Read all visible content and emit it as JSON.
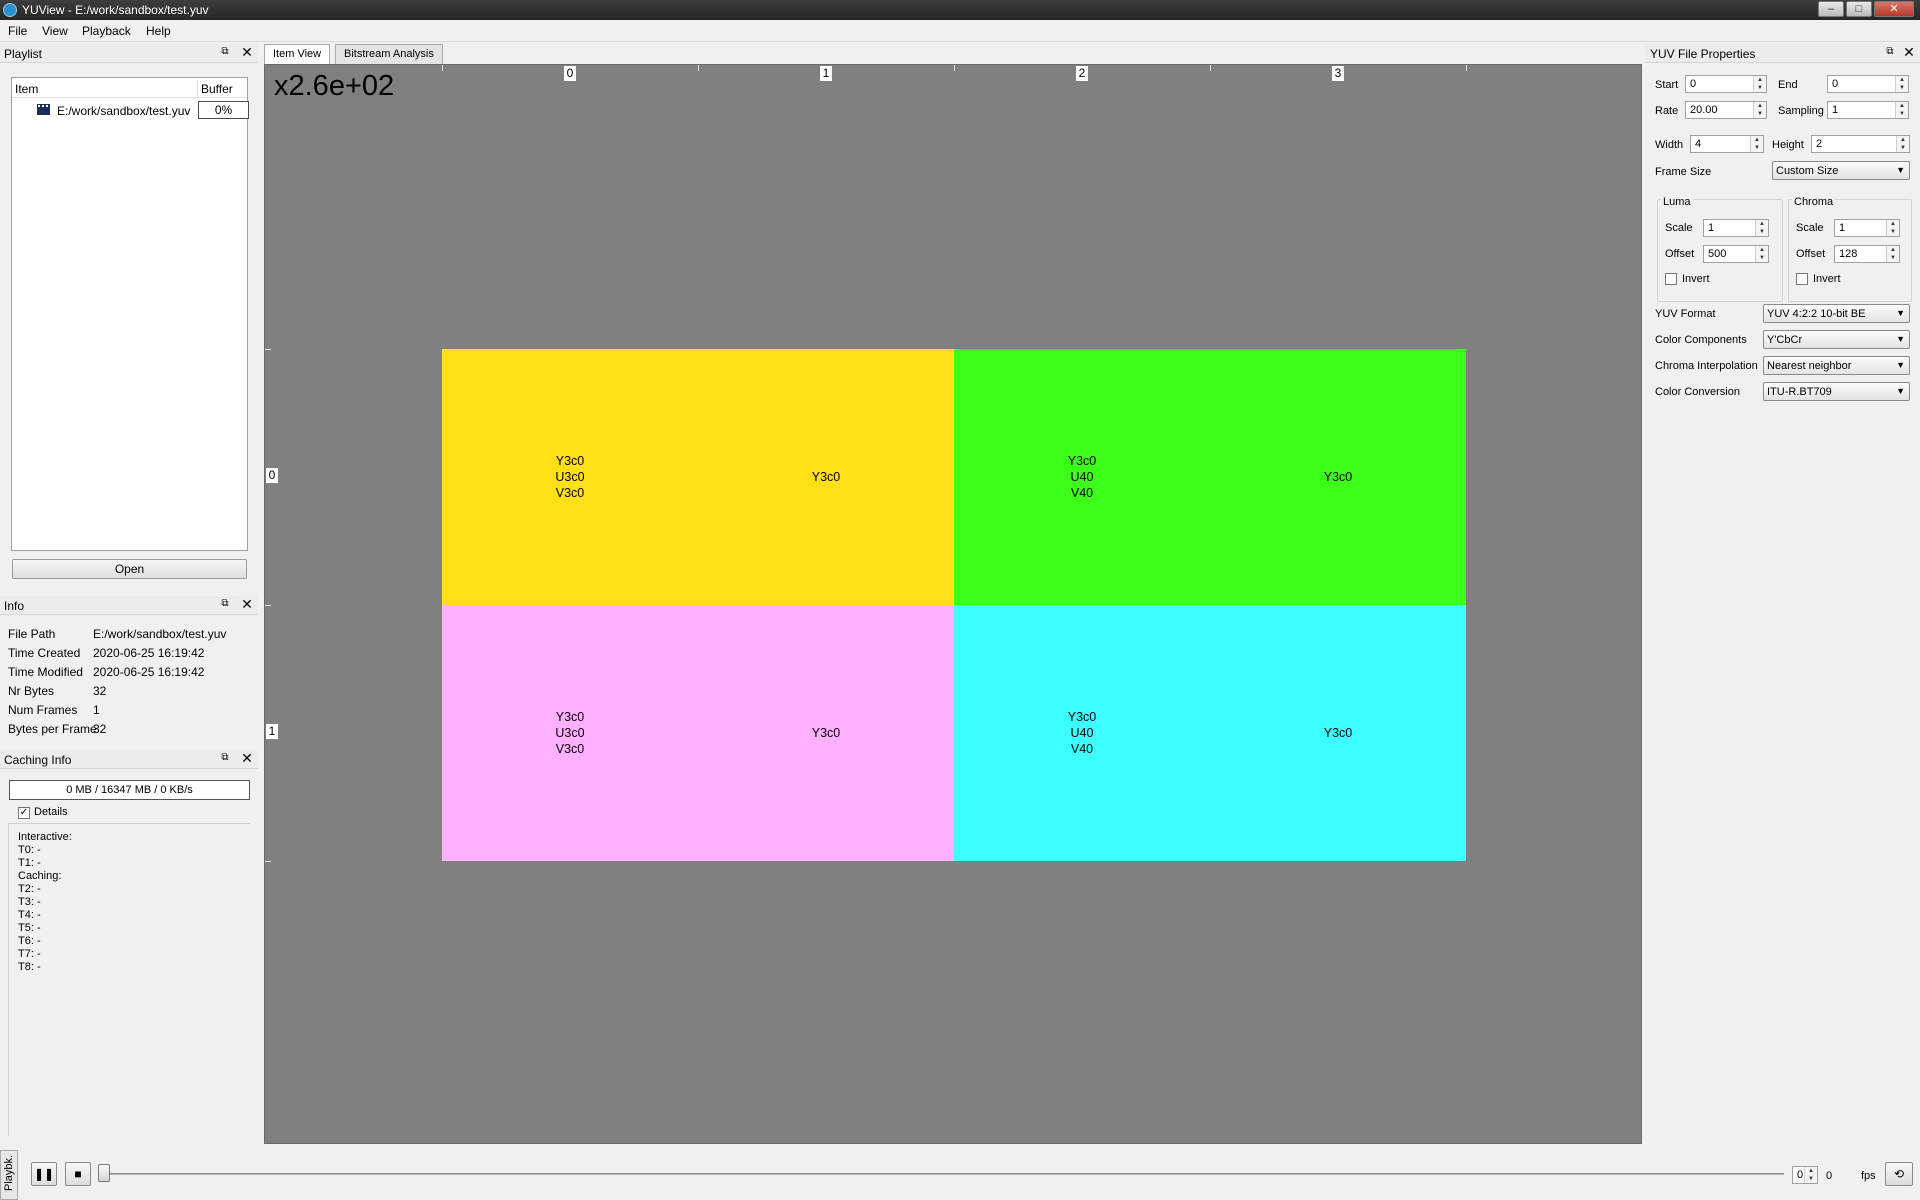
{
  "window": {
    "title": "YUView - E:/work/sandbox/test.yuv",
    "buttons": [
      "–",
      "□",
      "✕"
    ]
  },
  "menu": [
    "File",
    "View",
    "Playback",
    "Help"
  ],
  "playlist": {
    "title": "Playlist",
    "col_item": "Item",
    "col_buffer": "Buffer",
    "items": [
      {
        "name": "E:/work/sandbox/test.yuv",
        "buffer": "0%"
      }
    ],
    "open_label": "Open"
  },
  "info": {
    "title": "Info",
    "rows": [
      {
        "key": "File Path",
        "value": "E:/work/sandbox/test.yuv"
      },
      {
        "key": "Time Created",
        "value": "2020-06-25 16:19:42"
      },
      {
        "key": "Time Modified",
        "value": "2020-06-25 16:19:42"
      },
      {
        "key": "Nr Bytes",
        "value": "32"
      },
      {
        "key": "Num Frames",
        "value": "1"
      },
      {
        "key": "Bytes per Frame",
        "value": "32"
      }
    ]
  },
  "caching": {
    "title": "Caching Info",
    "status": "0 MB / 16347 MB / 0 KB/s",
    "details_label": "Details",
    "details_checked": true,
    "lines": [
      "Interactive:",
      "T0: -",
      "T1: -",
      "Caching:",
      "T2: -",
      "T3: -",
      "T4: -",
      "T5: -",
      "T6: -",
      "T7: -",
      "T8: -"
    ]
  },
  "tabs": [
    "Item View",
    "Bitstream Analysis"
  ],
  "view": {
    "zoom_label": "x2.6e+02",
    "col_labels": [
      "0",
      "1",
      "2",
      "3"
    ],
    "row_labels": [
      "0",
      "1"
    ],
    "colors": {
      "yellow": "#ffe017",
      "green": "#3cff18",
      "pink": "#ffb0ff",
      "cyan": "#3cffff",
      "background": "#808080"
    },
    "pixels": [
      {
        "lines": [
          "Y3c0",
          "U3c0",
          "V3c0"
        ]
      },
      {
        "lines": [
          "Y3c0"
        ]
      },
      {
        "lines": [
          "Y3c0",
          "U40",
          "V40"
        ]
      },
      {
        "lines": [
          "Y3c0"
        ]
      },
      {
        "lines": [
          "Y3c0",
          "U3c0",
          "V3c0"
        ]
      },
      {
        "lines": [
          "Y3c0"
        ]
      },
      {
        "lines": [
          "Y3c0",
          "U40",
          "V40"
        ]
      },
      {
        "lines": [
          "Y3c0"
        ]
      }
    ]
  },
  "properties": {
    "title": "YUV File Properties",
    "start_label": "Start",
    "start": "0",
    "end_label": "End",
    "end": "0",
    "rate_label": "Rate",
    "rate": "20.00",
    "sampling_label": "Sampling",
    "sampling": "1",
    "width_label": "Width",
    "width": "4",
    "height_label": "Height",
    "height": "2",
    "frame_size_label": "Frame Size",
    "frame_size": "Custom Size",
    "luma": {
      "title": "Luma",
      "scale_label": "Scale",
      "scale": "1",
      "offset_label": "Offset",
      "offset": "500",
      "invert_label": "Invert"
    },
    "chroma": {
      "title": "Chroma",
      "scale_label": "Scale",
      "scale": "1",
      "offset_label": "Offset",
      "offset": "128",
      "invert_label": "Invert"
    },
    "yuv_format_label": "YUV Format",
    "yuv_format": "YUV 4:2:2 10-bit BE",
    "color_components_label": "Color Components",
    "color_components": "Y'CbCr",
    "chroma_interp_label": "Chroma Interpolation",
    "chroma_interp": "Nearest neighbor",
    "color_conversion_label": "Color Conversion",
    "color_conversion": "ITU-R.BT709"
  },
  "playback": {
    "side_tab": "Playbk.",
    "frame": "0",
    "fps_value": "0",
    "fps_label": "fps"
  }
}
